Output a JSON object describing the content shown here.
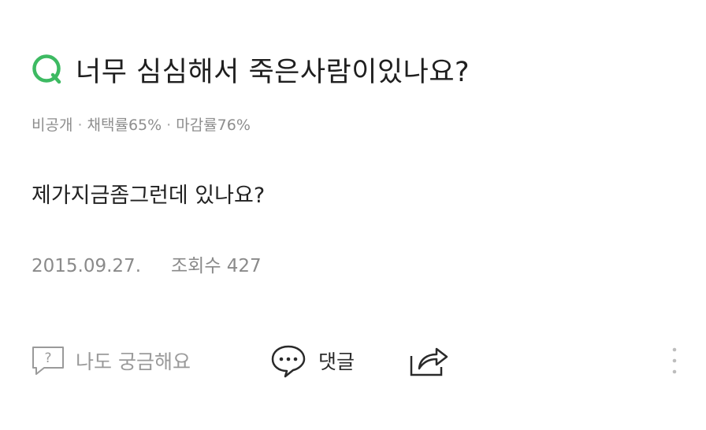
{
  "question": {
    "title": "너무 심심해서 죽은사람이있나요?",
    "icon": "q-icon",
    "accent_color": "#3dba62"
  },
  "meta": {
    "visibility": "비공개",
    "adoption_rate": "채택률65%",
    "deadline_rate": "마감률76%",
    "separator": "·"
  },
  "body": {
    "text": "제가지금좀그런데 있나요?"
  },
  "info": {
    "date": "2015.09.27.",
    "views": "조회수 427"
  },
  "actions": {
    "curious_label": "나도 궁금해요",
    "curious_icon": "question-speech-icon",
    "comment_label": "댓글",
    "comment_icon": "speech-bubble-icon",
    "share_icon": "share-icon",
    "more_icon": "vertical-dots-icon"
  }
}
